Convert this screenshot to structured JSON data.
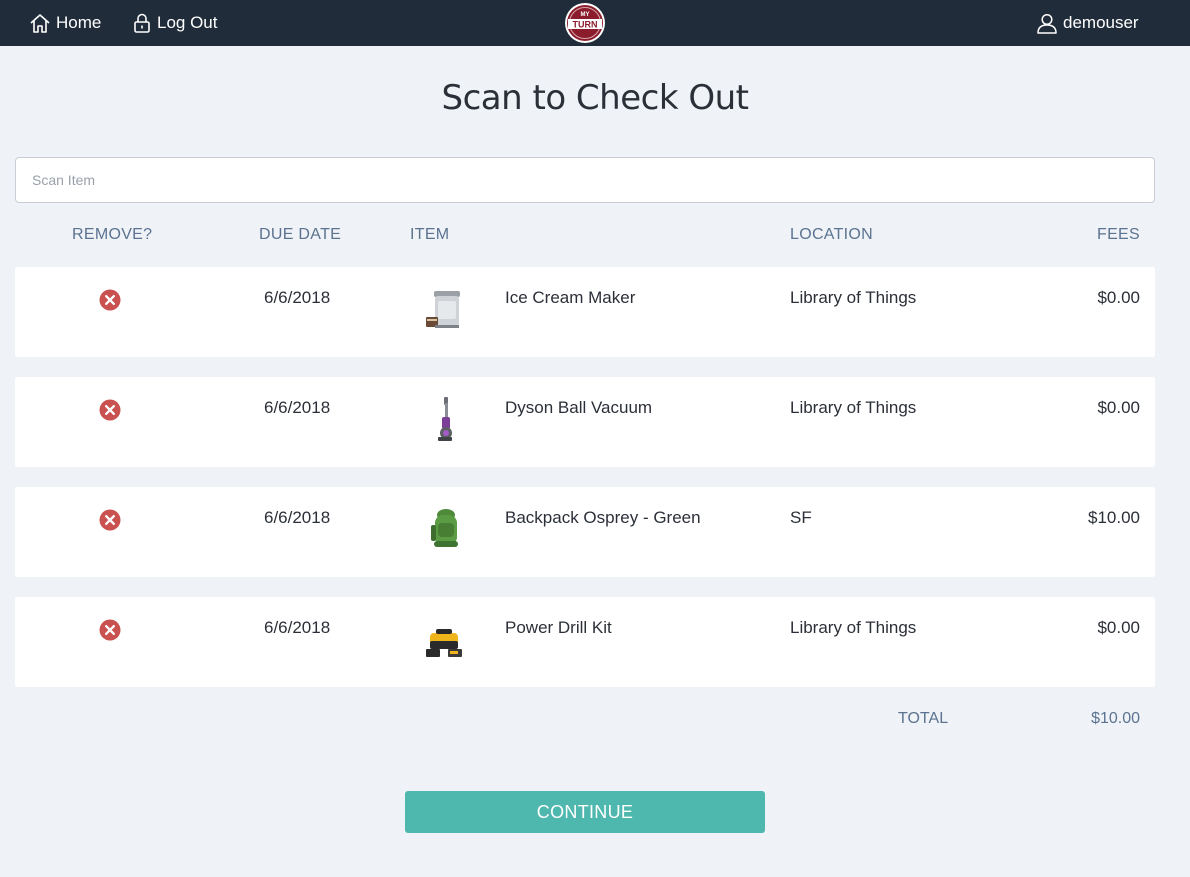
{
  "nav": {
    "home_label": "Home",
    "logout_label": "Log Out",
    "username": "demouser"
  },
  "brand": {
    "logo_text_top": "MY",
    "logo_text_main": "TURN",
    "color_primary": "#8b1c2c"
  },
  "page": {
    "title": "Scan to Check Out"
  },
  "scan": {
    "placeholder": "Scan Item"
  },
  "table": {
    "headers": {
      "remove": "REMOVE?",
      "due_date": "DUE DATE",
      "item": "ITEM",
      "location": "LOCATION",
      "fees": "FEES"
    },
    "rows": [
      {
        "due_date": "6/6/2018",
        "item": "Ice Cream Maker",
        "location": "Library of Things",
        "fee": "$0.00",
        "icon": "ice-cream-maker-thumbnail"
      },
      {
        "due_date": "6/6/2018",
        "item": "Dyson Ball Vacuum",
        "location": "Library of Things",
        "fee": "$0.00",
        "icon": "vacuum-thumbnail"
      },
      {
        "due_date": "6/6/2018",
        "item": "Backpack Osprey - Green",
        "location": "SF",
        "fee": "$10.00",
        "icon": "backpack-thumbnail"
      },
      {
        "due_date": "6/6/2018",
        "item": "Power Drill Kit",
        "location": "Library of Things",
        "fee": "$0.00",
        "icon": "drill-kit-thumbnail"
      }
    ]
  },
  "totals": {
    "label": "TOTAL",
    "value": "$10.00"
  },
  "actions": {
    "continue_label": "CONTINUE"
  },
  "colors": {
    "topbar": "#212c3a",
    "accent": "#4fb8ae",
    "remove": "#c9514f",
    "header_text": "#5b7390"
  }
}
